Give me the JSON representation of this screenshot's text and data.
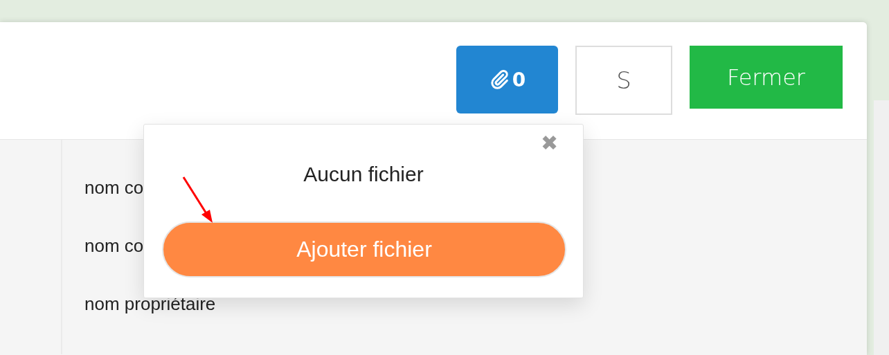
{
  "toolbar": {
    "attachments_count": "0",
    "s_button": "S",
    "close_button": "Fermer"
  },
  "fields": [
    {
      "label": "nom co"
    },
    {
      "label": "nom co"
    },
    {
      "label": "nom propriétaire"
    }
  ],
  "popup": {
    "close_glyph": "✖",
    "message": "Aucun fichier",
    "add_button": "Ajouter fichier"
  }
}
